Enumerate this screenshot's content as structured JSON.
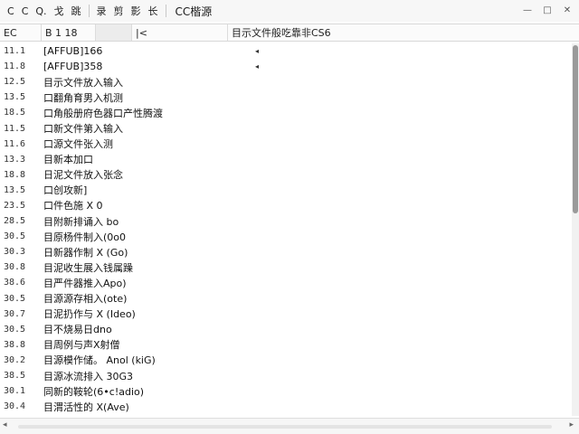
{
  "toolbar": {
    "items": [
      "C",
      "C",
      "Q.",
      "戈",
      "跳",
      "录",
      "剪",
      "影",
      "长"
    ],
    "title": "CC楷源",
    "win_controls": [
      "—",
      "□",
      "✕"
    ]
  },
  "header": {
    "col1": "EC",
    "col2": "B 1 18",
    "col3": "",
    "col4": "|<",
    "col5": "目示文件般吃靠非CS6"
  },
  "rows": [
    {
      "num": "11.1",
      "name": "[AFFUB]166",
      "mark": "◂"
    },
    {
      "num": "11.8",
      "name": "[AFFUB]358",
      "mark": "◂"
    },
    {
      "num": "12.5",
      "name": "目示文件放入输入",
      "mark": ""
    },
    {
      "num": "13.5",
      "name": "口翻角育男入机测",
      "mark": ""
    },
    {
      "num": "18.5",
      "name": "口角般册府色器口产性腾渡",
      "mark": ""
    },
    {
      "num": "11.5",
      "name": "口新文件第入输入",
      "mark": ""
    },
    {
      "num": "11.6",
      "name": "口源文件张入测",
      "mark": ""
    },
    {
      "num": "13.3",
      "name": "目新本加口",
      "mark": ""
    },
    {
      "num": "18.8",
      "name": "日泥文件放入张念",
      "mark": ""
    },
    {
      "num": "13.5",
      "name": "口创攻新]",
      "mark": ""
    },
    {
      "num": "23.5",
      "name": "口件色施 X 0",
      "mark": ""
    },
    {
      "num": "28.5",
      "name": "目附新排诵入 bo",
      "mark": ""
    },
    {
      "num": "30.5",
      "name": "目原杨件制入(0o0",
      "mark": ""
    },
    {
      "num": "30.3",
      "name": "日新器作制 X (Go)",
      "mark": ""
    },
    {
      "num": "30.8",
      "name": "目泥收生展入钱属躁",
      "mark": ""
    },
    {
      "num": "38.6",
      "name": "目严件器推入Apo)",
      "mark": ""
    },
    {
      "num": "30.5",
      "name": "目源源存相入(ote)",
      "mark": ""
    },
    {
      "num": "30.7",
      "name": "日泥扔作与 X (Ideo)",
      "mark": ""
    },
    {
      "num": "30.5",
      "name": "目不烧易日dno",
      "mark": ""
    },
    {
      "num": "38.8",
      "name": "目周例与声X射僧",
      "mark": ""
    },
    {
      "num": "30.2",
      "name": "目源模作储。 Anol   (kiG)",
      "mark": ""
    },
    {
      "num": "38.5",
      "name": "目源冰流排入 30G3",
      "mark": ""
    },
    {
      "num": "30.1",
      "name": "同新的鞍轮(6•c!adio)",
      "mark": ""
    },
    {
      "num": "30.4",
      "name": "目渭活性的 X(Ave)",
      "mark": ""
    }
  ],
  "statusbar": {
    "left": "◂",
    "right": "▸"
  }
}
